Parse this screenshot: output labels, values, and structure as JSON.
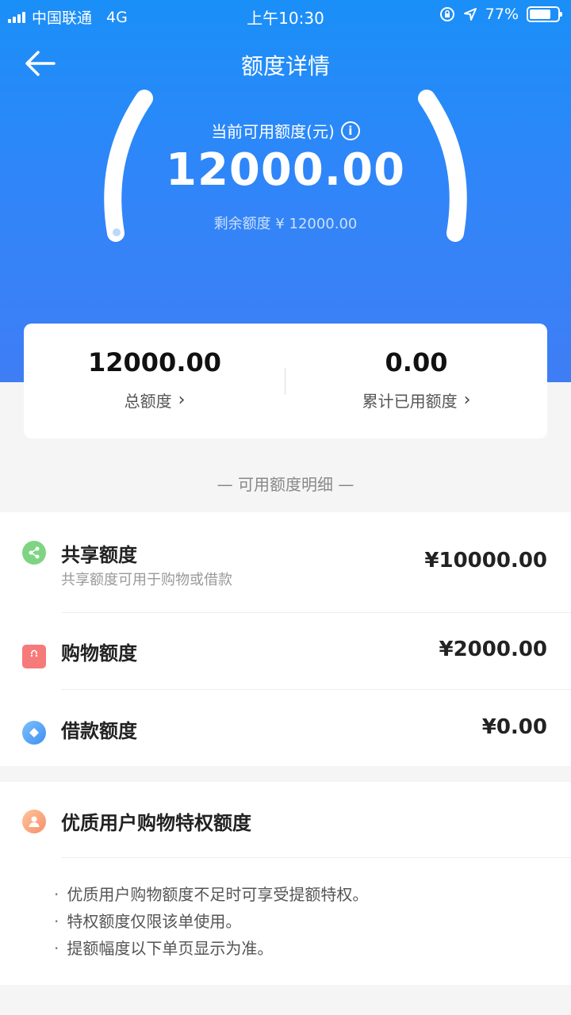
{
  "status_bar": {
    "carrier": "中国联通",
    "network": "4G",
    "time": "上午10:30",
    "battery": "77%",
    "battery_level": 0.77
  },
  "nav": {
    "title": "额度详情",
    "back_icon": "back-arrow-icon"
  },
  "gauge": {
    "label": "当前可用额度(元)",
    "amount": "12000.00",
    "remaining": "剩余额度 ¥ 12000.00"
  },
  "summary": {
    "total_value": "12000.00",
    "total_label": "总额度",
    "used_value": "0.00",
    "used_label": "累计已用额度"
  },
  "section_title": "— 可用额度明细 —",
  "credit_items": [
    {
      "name": "共享额度",
      "desc": "共享额度可用于购物或借款",
      "amount": "¥10000.00",
      "icon": "share-icon",
      "color": "#7ed482"
    },
    {
      "name": "购物额度",
      "amount": "¥2000.00",
      "icon": "shopping-bag-icon",
      "color": "#f77a7a"
    },
    {
      "name": "借款额度",
      "amount": "¥0.00",
      "icon": "diamond-icon",
      "color": "#5aa6f7"
    }
  ],
  "privilege": {
    "title": "优质用户购物特权额度",
    "icon": "user-icon",
    "notes": [
      "优质用户购物额度不足时可享受提额特权。",
      "特权额度仅限该单使用。",
      "提额幅度以下单页显示为准。"
    ]
  }
}
